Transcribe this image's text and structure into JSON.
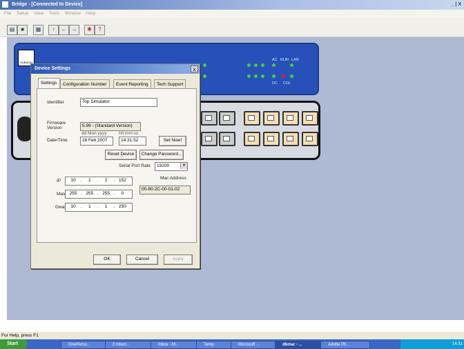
{
  "window": {
    "title": "Bridge - [Connected to Device]",
    "controls": "_ | X"
  },
  "menu": [
    "File",
    "Setup",
    "View",
    "Tools",
    "Window",
    "Help"
  ],
  "device": {
    "brand": "HUB&DIO",
    "leds": {
      "ac": "AC",
      "run": "RUN",
      "lan": "LAN",
      "dc": "DC",
      "col": "COL"
    }
  },
  "dialog": {
    "title": "Device Settings",
    "close": "x",
    "tabs": [
      "Settings",
      "Configuration Number",
      "Event Reporting",
      "Tech Support"
    ],
    "identifier_label": "Identifier",
    "identifier_value": "Top Simulator",
    "firmware_label": "Firmware Version",
    "firmware_value": "5.99 - (Standard Version)",
    "date_format": "dd Mon yyyy",
    "time_format": "hh:mm:ss",
    "datetime_label": "Date/Time",
    "date_value": "28 Feb 2007",
    "time_value": "14:31:52",
    "set_now": "Set Now!",
    "reset_device": "Reset Device",
    "change_password": "Change Password...",
    "serial_label": "Serial Port Rate",
    "serial_value": "19200",
    "ip_label": "IP",
    "ip": [
      "10",
      "1",
      "2",
      "152"
    ],
    "mask_label": "Mask",
    "mask": [
      "255",
      "255",
      "255",
      "0"
    ],
    "gway_label": "Gway",
    "gway": [
      "10",
      "1",
      "1",
      "250"
    ],
    "mac_label": "Mac Address",
    "mac_value": "00-80-2C-00-01-02",
    "ok": "OK",
    "cancel": "Cancel",
    "apply": "Apply"
  },
  "status": "For Help, press F1",
  "taskbar": {
    "start": "Start",
    "tasks": [
      "OnePerso...",
      "2 Intern...",
      "Inbox - M...",
      "Temp",
      "Microsoft ...",
      "dbmar - ...",
      "Adobe Ph..."
    ],
    "clock": "14:31"
  }
}
